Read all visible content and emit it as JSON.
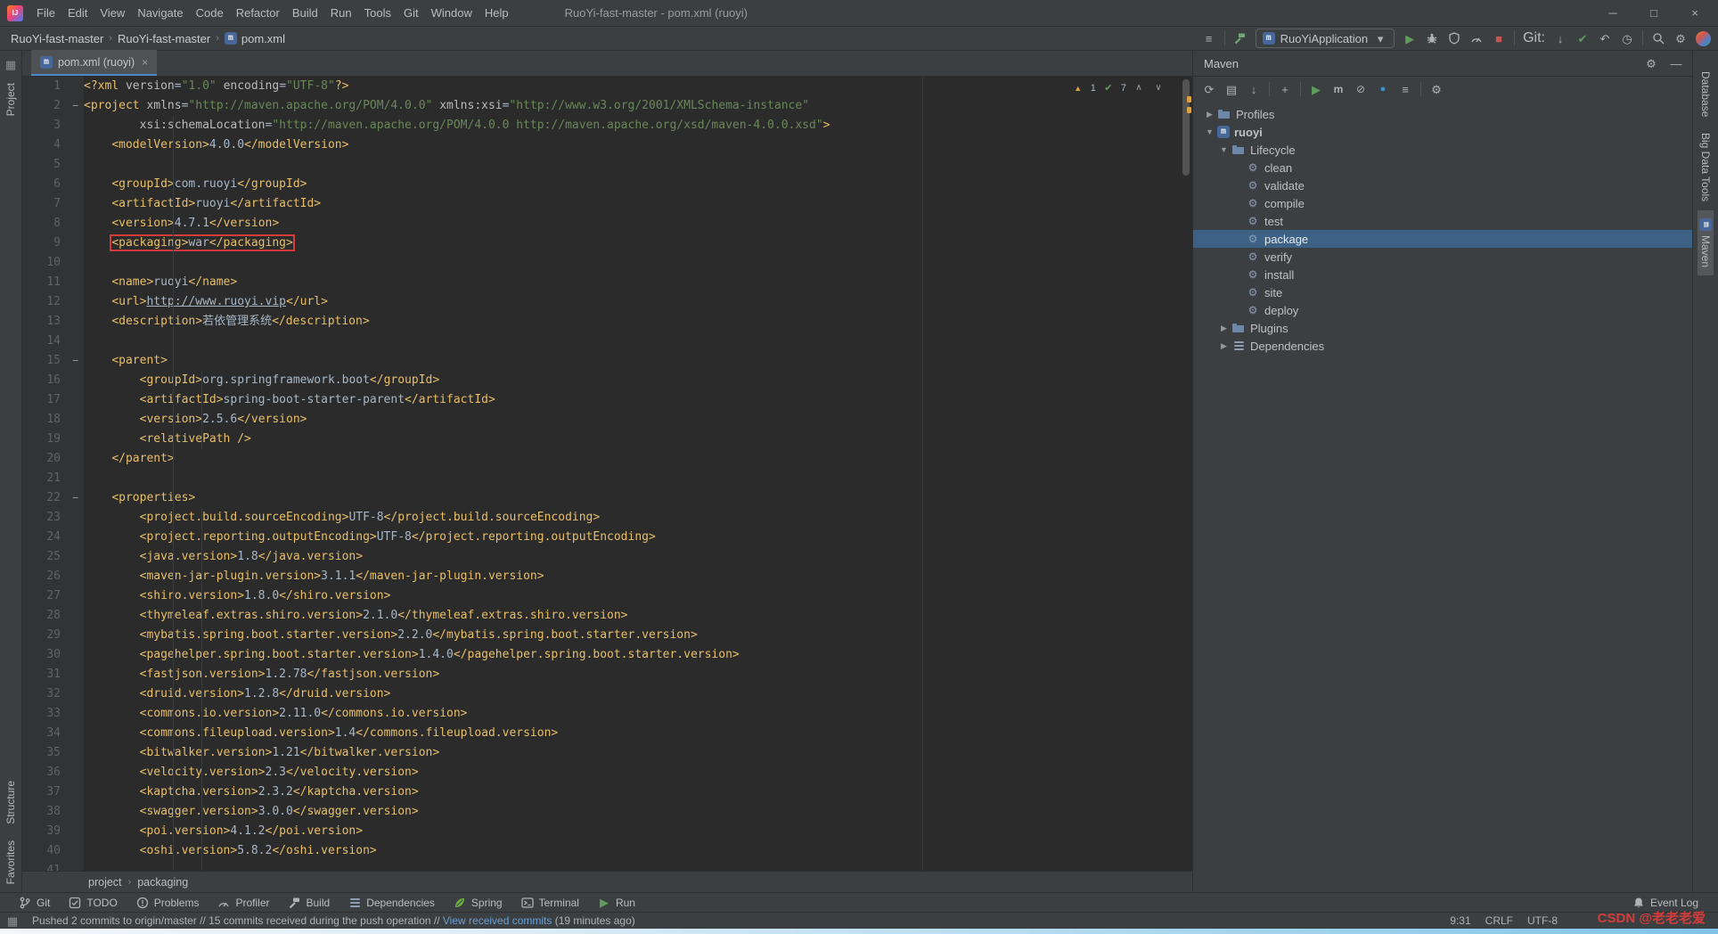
{
  "title_bar": {
    "menus": [
      "File",
      "Edit",
      "View",
      "Navigate",
      "Code",
      "Refactor",
      "Build",
      "Run",
      "Tools",
      "Git",
      "Window",
      "Help"
    ],
    "title": "RuoYi-fast-master - pom.xml (ruoyi)"
  },
  "nav_bar": {
    "breadcrumbs": [
      {
        "label": "RuoYi-fast-master"
      },
      {
        "label": "RuoYi-fast-master"
      },
      {
        "label": "pom.xml",
        "icon": "maven"
      }
    ],
    "run_config": "RuoYiApplication",
    "git_label": "Git:",
    "actions": [
      {
        "icon": "view-options"
      },
      {
        "sep": true
      },
      {
        "icon": "hammer",
        "name": "build-project"
      },
      {
        "combo": true
      },
      {
        "icon": "run"
      },
      {
        "icon": "bug",
        "name": "debug"
      },
      {
        "icon": "coverage",
        "name": "run-with-coverage"
      },
      {
        "icon": "profiler"
      },
      {
        "icon": "stop"
      },
      {
        "sep": true
      },
      {
        "git_label": true
      },
      {
        "icon": "update-project"
      },
      {
        "icon": "commit"
      },
      {
        "icon": "rollback"
      },
      {
        "icon": "show-history"
      },
      {
        "sep": true
      },
      {
        "icon": "search",
        "name": "search-everywhere"
      },
      {
        "icon": "settings"
      },
      {
        "icon": "avatar",
        "name": "profile-avatar"
      }
    ]
  },
  "left_stripe": {
    "top": [
      {
        "label": "Project"
      }
    ],
    "bottom": [
      {
        "label": "Structure"
      },
      {
        "label": "Favorites"
      }
    ]
  },
  "right_stripe": {
    "items": [
      {
        "label": "Database"
      },
      {
        "label": "Big Data Tools"
      },
      {
        "label": "Maven",
        "icon": "maven",
        "active": true
      }
    ]
  },
  "editor": {
    "tab_label": "pom.xml (ruoyi)",
    "inspections": {
      "warning_count": "1",
      "ok_count": "7"
    },
    "breadcrumbs": [
      "project",
      "packaging"
    ],
    "code": {
      "lines": [
        {
          "n": 1,
          "segs": [
            [
              "tg",
              "<?xml "
            ],
            [
              "at",
              "version"
            ],
            [
              "tx",
              "="
            ],
            [
              "st",
              "\"1.0\""
            ],
            [
              "tx",
              " "
            ],
            [
              "at",
              "encoding"
            ],
            [
              "tx",
              "="
            ],
            [
              "st",
              "\"UTF-8\""
            ],
            [
              "tg",
              "?>"
            ]
          ]
        },
        {
          "n": 2,
          "fold": true,
          "segs": [
            [
              "tg",
              "<project "
            ],
            [
              "at",
              "xmlns"
            ],
            [
              "tx",
              "="
            ],
            [
              "st",
              "\"http://maven.apache.org/POM/4.0.0\""
            ],
            [
              "tx",
              " "
            ],
            [
              "at",
              "xmlns:xsi"
            ],
            [
              "tx",
              "="
            ],
            [
              "st",
              "\"http://www.w3.org/2001/XMLSchema-instance\""
            ]
          ]
        },
        {
          "n": 3,
          "segs": [
            [
              "tx",
              "        "
            ],
            [
              "at",
              "xsi:schemaLocation"
            ],
            [
              "tx",
              "="
            ],
            [
              "st",
              "\"http://maven.apache.org/POM/4.0.0 http://maven.apache.org/xsd/maven-4.0.0.xsd\""
            ],
            [
              "tg",
              ">"
            ]
          ]
        },
        {
          "n": 4,
          "segs": [
            [
              "tx",
              "    "
            ],
            [
              "tg",
              "<modelVersion>"
            ],
            [
              "tx",
              "4.0.0"
            ],
            [
              "tg",
              "</modelVersion>"
            ]
          ]
        },
        {
          "n": 5,
          "segs": []
        },
        {
          "n": 6,
          "segs": [
            [
              "tx",
              "    "
            ],
            [
              "tg",
              "<groupId>"
            ],
            [
              "tx",
              "com.ruoyi"
            ],
            [
              "tg",
              "</groupId>"
            ]
          ]
        },
        {
          "n": 7,
          "segs": [
            [
              "tx",
              "    "
            ],
            [
              "tg",
              "<artifactId>"
            ],
            [
              "tx",
              "ruoyi"
            ],
            [
              "tg",
              "</artifactId>"
            ]
          ]
        },
        {
          "n": 8,
          "segs": [
            [
              "tx",
              "    "
            ],
            [
              "tg",
              "<version>"
            ],
            [
              "tx",
              "4.7.1"
            ],
            [
              "tg",
              "</version>"
            ]
          ]
        },
        {
          "n": 9,
          "box": [
            1,
            3
          ],
          "segs": [
            [
              "tx",
              "    "
            ],
            [
              "tg",
              "<packaging>"
            ],
            [
              "tx",
              "war"
            ],
            [
              "tg",
              "</packaging>"
            ]
          ]
        },
        {
          "n": 10,
          "segs": []
        },
        {
          "n": 11,
          "segs": [
            [
              "tx",
              "    "
            ],
            [
              "tg",
              "<name>"
            ],
            [
              "tx",
              "ruoyi"
            ],
            [
              "tg",
              "</name>"
            ]
          ]
        },
        {
          "n": 12,
          "segs": [
            [
              "tx",
              "    "
            ],
            [
              "tg",
              "<url>"
            ],
            [
              "ln",
              "http://www.ruoyi.vip"
            ],
            [
              "tg",
              "</url>"
            ]
          ]
        },
        {
          "n": 13,
          "segs": [
            [
              "tx",
              "    "
            ],
            [
              "tg",
              "<description>"
            ],
            [
              "tx",
              "若依管理系统"
            ],
            [
              "tg",
              "</description>"
            ]
          ]
        },
        {
          "n": 14,
          "segs": []
        },
        {
          "n": 15,
          "fold": true,
          "segs": [
            [
              "tx",
              "    "
            ],
            [
              "tg",
              "<parent>"
            ]
          ]
        },
        {
          "n": 16,
          "segs": [
            [
              "tx",
              "        "
            ],
            [
              "tg",
              "<groupId>"
            ],
            [
              "tx",
              "org.springframework.boot"
            ],
            [
              "tg",
              "</groupId>"
            ]
          ]
        },
        {
          "n": 17,
          "segs": [
            [
              "tx",
              "        "
            ],
            [
              "tg",
              "<artifactId>"
            ],
            [
              "tx",
              "spring-boot-starter-parent"
            ],
            [
              "tg",
              "</artifactId>"
            ]
          ]
        },
        {
          "n": 18,
          "segs": [
            [
              "tx",
              "        "
            ],
            [
              "tg",
              "<version>"
            ],
            [
              "tx",
              "2.5.6"
            ],
            [
              "tg",
              "</version>"
            ]
          ]
        },
        {
          "n": 19,
          "segs": [
            [
              "tx",
              "        "
            ],
            [
              "tg",
              "<relativePath />"
            ]
          ]
        },
        {
          "n": 20,
          "segs": [
            [
              "tx",
              "    "
            ],
            [
              "tg",
              "</parent>"
            ]
          ]
        },
        {
          "n": 21,
          "segs": []
        },
        {
          "n": 22,
          "fold": true,
          "segs": [
            [
              "tx",
              "    "
            ],
            [
              "tg",
              "<properties>"
            ]
          ]
        },
        {
          "n": 23,
          "segs": [
            [
              "tx",
              "        "
            ],
            [
              "tg",
              "<project.build.sourceEncoding>"
            ],
            [
              "tx",
              "UTF-8"
            ],
            [
              "tg",
              "</project.build.sourceEncoding>"
            ]
          ]
        },
        {
          "n": 24,
          "segs": [
            [
              "tx",
              "        "
            ],
            [
              "tg",
              "<project.reporting.outputEncoding>"
            ],
            [
              "tx",
              "UTF-8"
            ],
            [
              "tg",
              "</project.reporting.outputEncoding>"
            ]
          ]
        },
        {
          "n": 25,
          "segs": [
            [
              "tx",
              "        "
            ],
            [
              "tg",
              "<java.version>"
            ],
            [
              "tx",
              "1.8"
            ],
            [
              "tg",
              "</java.version>"
            ]
          ]
        },
        {
          "n": 26,
          "segs": [
            [
              "tx",
              "        "
            ],
            [
              "tg",
              "<maven-jar-plugin.version>"
            ],
            [
              "tx",
              "3.1.1"
            ],
            [
              "tg",
              "</maven-jar-plugin.version>"
            ]
          ]
        },
        {
          "n": 27,
          "segs": [
            [
              "tx",
              "        "
            ],
            [
              "tg",
              "<shiro.version>"
            ],
            [
              "tx",
              "1.8.0"
            ],
            [
              "tg",
              "</shiro.version>"
            ]
          ]
        },
        {
          "n": 28,
          "segs": [
            [
              "tx",
              "        "
            ],
            [
              "tg",
              "<thymeleaf.extras.shiro.version>"
            ],
            [
              "tx",
              "2.1.0"
            ],
            [
              "tg",
              "</thymeleaf.extras.shiro.version>"
            ]
          ]
        },
        {
          "n": 29,
          "segs": [
            [
              "tx",
              "        "
            ],
            [
              "tg",
              "<mybatis.spring.boot.starter.version>"
            ],
            [
              "tx",
              "2.2.0"
            ],
            [
              "tg",
              "</mybatis.spring.boot.starter.version>"
            ]
          ]
        },
        {
          "n": 30,
          "segs": [
            [
              "tx",
              "        "
            ],
            [
              "tg",
              "<pagehelper.spring.boot.starter.version>"
            ],
            [
              "tx",
              "1.4.0"
            ],
            [
              "tg",
              "</pagehelper.spring.boot.starter.version>"
            ]
          ]
        },
        {
          "n": 31,
          "segs": [
            [
              "tx",
              "        "
            ],
            [
              "tg",
              "<fastjson.version>"
            ],
            [
              "tx",
              "1.2.78"
            ],
            [
              "tg",
              "</fastjson.version>"
            ]
          ]
        },
        {
          "n": 32,
          "segs": [
            [
              "tx",
              "        "
            ],
            [
              "tg",
              "<druid.version>"
            ],
            [
              "tx",
              "1.2.8"
            ],
            [
              "tg",
              "</druid.version>"
            ]
          ]
        },
        {
          "n": 33,
          "segs": [
            [
              "tx",
              "        "
            ],
            [
              "tg",
              "<commons.io.version>"
            ],
            [
              "tx",
              "2.11.0"
            ],
            [
              "tg",
              "</commons.io.version>"
            ]
          ]
        },
        {
          "n": 34,
          "segs": [
            [
              "tx",
              "        "
            ],
            [
              "tg",
              "<commons.fileupload.version>"
            ],
            [
              "tx",
              "1.4"
            ],
            [
              "tg",
              "</commons.fileupload.version>"
            ]
          ]
        },
        {
          "n": 35,
          "segs": [
            [
              "tx",
              "        "
            ],
            [
              "tg",
              "<bitwalker.version>"
            ],
            [
              "tx",
              "1.21"
            ],
            [
              "tg",
              "</bitwalker.version>"
            ]
          ]
        },
        {
          "n": 36,
          "segs": [
            [
              "tx",
              "        "
            ],
            [
              "tg",
              "<velocity.version>"
            ],
            [
              "tx",
              "2.3"
            ],
            [
              "tg",
              "</velocity.version>"
            ]
          ]
        },
        {
          "n": 37,
          "segs": [
            [
              "tx",
              "        "
            ],
            [
              "tg",
              "<kaptcha.version>"
            ],
            [
              "tx",
              "2.3.2"
            ],
            [
              "tg",
              "</kaptcha.version>"
            ]
          ]
        },
        {
          "n": 38,
          "segs": [
            [
              "tx",
              "        "
            ],
            [
              "tg",
              "<swagger.version>"
            ],
            [
              "tx",
              "3.0.0"
            ],
            [
              "tg",
              "</swagger.version>"
            ]
          ]
        },
        {
          "n": 39,
          "segs": [
            [
              "tx",
              "        "
            ],
            [
              "tg",
              "<poi.version>"
            ],
            [
              "tx",
              "4.1.2"
            ],
            [
              "tg",
              "</poi.version>"
            ]
          ]
        },
        {
          "n": 40,
          "segs": [
            [
              "tx",
              "        "
            ],
            [
              "tg",
              "<oshi.version>"
            ],
            [
              "tx",
              "5.8.2"
            ],
            [
              "tg",
              "</oshi.version>"
            ]
          ]
        },
        {
          "n": 41,
          "segs": []
        }
      ]
    }
  },
  "maven": {
    "title": "Maven",
    "toolbar": [
      "reload-maven",
      "generate-sources",
      "download-sources",
      "|",
      "add-maven-project",
      "|",
      "run-maven-build",
      "execute-maven-goal",
      "skip-tests",
      "toggle-offline",
      "show-profiles",
      "|",
      "maven-settings"
    ],
    "tree": [
      {
        "label": "Profiles",
        "indent": 0,
        "chevron": "right",
        "icon": "profiles-folder"
      },
      {
        "label": "ruoyi",
        "indent": 0,
        "chevron": "down",
        "icon": "maven-module",
        "bold": true
      },
      {
        "label": "Lifecycle",
        "indent": 1,
        "chevron": "down",
        "icon": "lifecycle-folder"
      },
      {
        "label": "clean",
        "indent": 2,
        "icon": "goal-gear"
      },
      {
        "label": "validate",
        "indent": 2,
        "icon": "goal-gear"
      },
      {
        "label": "compile",
        "indent": 2,
        "icon": "goal-gear"
      },
      {
        "label": "test",
        "indent": 2,
        "icon": "goal-gear"
      },
      {
        "label": "package",
        "indent": 2,
        "icon": "goal-gear",
        "selected": true
      },
      {
        "label": "verify",
        "indent": 2,
        "icon": "goal-gear"
      },
      {
        "label": "install",
        "indent": 2,
        "icon": "goal-gear"
      },
      {
        "label": "site",
        "indent": 2,
        "icon": "goal-gear"
      },
      {
        "label": "deploy",
        "indent": 2,
        "icon": "goal-gear"
      },
      {
        "label": "Plugins",
        "indent": 1,
        "chevron": "right",
        "icon": "plugins-folder"
      },
      {
        "label": "Dependencies",
        "indent": 1,
        "chevron": "right",
        "icon": "dependencies-list"
      }
    ]
  },
  "bottom_bar": {
    "left": [
      {
        "icon": "git-branch",
        "label": "Git"
      },
      {
        "icon": "todo",
        "label": "TODO"
      },
      {
        "icon": "problems",
        "label": "Problems"
      },
      {
        "icon": "profiler",
        "label": "Profiler"
      },
      {
        "icon": "hammer",
        "label": "Build"
      },
      {
        "icon": "deps",
        "label": "Dependencies"
      },
      {
        "icon": "spring-leaf",
        "label": "Spring"
      },
      {
        "icon": "terminal",
        "label": "Terminal"
      },
      {
        "icon": "run",
        "label": "Run"
      }
    ],
    "right": {
      "icon": "bell",
      "label": "Event Log"
    }
  },
  "status_bar": {
    "message": "Pushed 2 commits to origin/master // 15 commits received during the push operation // ",
    "link": "View received commits",
    "suffix": " (19 minutes ago)",
    "caret_position": "9:31",
    "line_separator": "CRLF",
    "encoding": "UTF-8"
  },
  "watermark": {
    "brand": "CSDN",
    "handle": "@老老老爱"
  }
}
